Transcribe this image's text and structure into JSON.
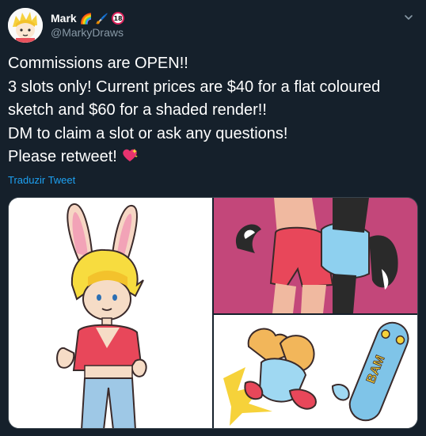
{
  "author": {
    "display_name": "Mark",
    "name_emoji": [
      "🌈",
      "🖌️"
    ],
    "age_badge": "18",
    "handle": "@MarkyDraws"
  },
  "tweet": {
    "text": "Commissions are OPEN!!\n3 slots only! Current prices are $40 for a flat coloured sketch and $60 for a shaded render!!\nDM to claim a slot or ask any questions!\nPlease retweet!",
    "emoji": "💖",
    "translate_label": "Traduzir Tweet"
  },
  "media_count": 3,
  "skateboard_text": "BAM",
  "colors": {
    "background": "#15202b",
    "secondary_text": "#8899a6",
    "link": "#1da1f2",
    "border": "#38444d"
  }
}
